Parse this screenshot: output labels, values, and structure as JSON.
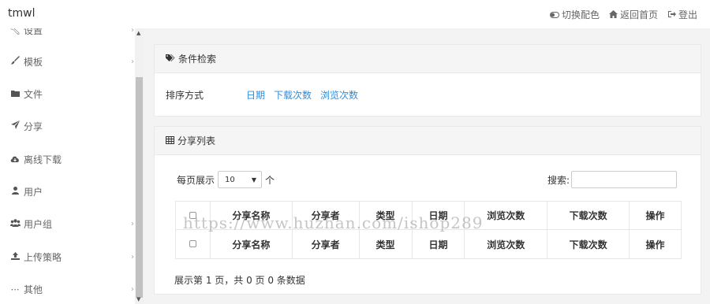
{
  "header": {
    "brand": "tmwl",
    "actions": [
      {
        "icon": "toggle-icon",
        "label": "切换配色"
      },
      {
        "icon": "home-icon",
        "label": "返回首页"
      },
      {
        "icon": "logout-icon",
        "label": "登出"
      }
    ]
  },
  "sidebar": {
    "items": [
      {
        "icon": "wrench-icon",
        "label": "设置",
        "has_children": true
      },
      {
        "icon": "brush-icon",
        "label": "模板",
        "has_children": true
      },
      {
        "icon": "folder-icon",
        "label": "文件",
        "has_children": false
      },
      {
        "icon": "send-icon",
        "label": "分享",
        "has_children": false
      },
      {
        "icon": "cloud-download-icon",
        "label": "离线下载",
        "has_children": false
      },
      {
        "icon": "user-icon",
        "label": "用户",
        "has_children": false
      },
      {
        "icon": "users-icon",
        "label": "用户组",
        "has_children": true
      },
      {
        "icon": "upload-icon",
        "label": "上传策略",
        "has_children": true
      },
      {
        "icon": "more-icon",
        "label": "其他",
        "has_children": true
      }
    ]
  },
  "filter": {
    "title": "条件检索",
    "sort_label": "排序方式",
    "sort_options": [
      "日期",
      "下载次数",
      "浏览次数"
    ]
  },
  "list": {
    "title": "分享列表",
    "per_page_prefix": "每页展示",
    "per_page_value": "10",
    "per_page_suffix": "个",
    "search_label": "搜索:",
    "search_value": "",
    "columns": [
      "分享名称",
      "分享者",
      "类型",
      "日期",
      "浏览次数",
      "下载次数",
      "操作"
    ],
    "info": "展示第 1 页，共 0 页 0 条数据"
  },
  "watermark": "https://www.huzhan.com/ishop289",
  "colors": {
    "link": "#2e8ddf",
    "panel_header": "#f5f5f5"
  }
}
